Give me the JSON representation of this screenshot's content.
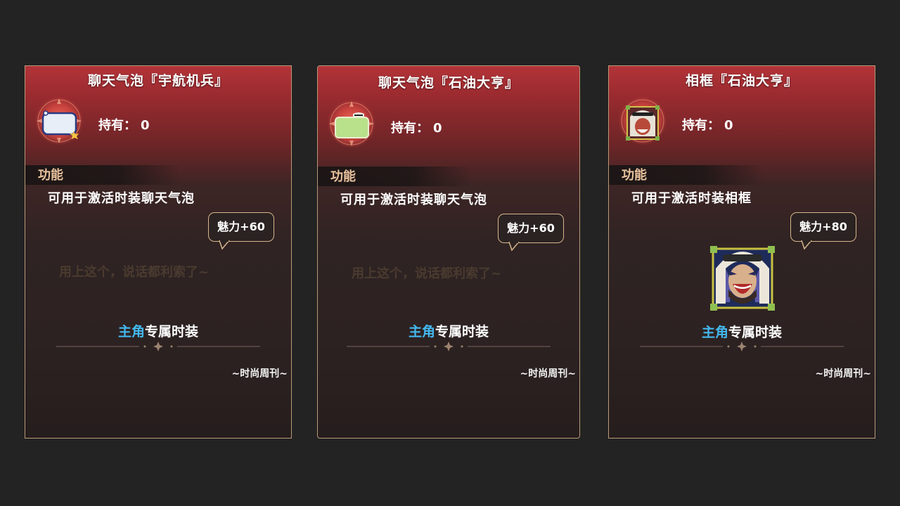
{
  "cards": [
    {
      "title": "聊天气泡『宇航机兵』",
      "owned_label": "持有：",
      "owned_value": "0",
      "section_label": "功能",
      "description": "可用于激活时装聊天气泡",
      "bonus": "魅力+60",
      "flavor_text": "用上这个，说话都利索了~",
      "exclusive_highlight": "主角",
      "exclusive_rest": "专属时装",
      "magazine": "~时尚周刊~",
      "icon": "chat-bubble-white-icon"
    },
    {
      "title": "聊天气泡『石油大亨』",
      "owned_label": "持有：",
      "owned_value": "0",
      "section_label": "功能",
      "description": "可用于激活时装聊天气泡",
      "bonus": "魅力+60",
      "flavor_text": "用上这个，说话都利索了~",
      "exclusive_highlight": "主角",
      "exclusive_rest": "专属时装",
      "magazine": "~时尚周刊~",
      "icon": "chat-bubble-green-icon"
    },
    {
      "title": "相框『石油大亨』",
      "owned_label": "持有：",
      "owned_value": "0",
      "section_label": "功能",
      "description": "可用于激活时装相框",
      "bonus": "魅力+80",
      "exclusive_highlight": "主角",
      "exclusive_rest": "专属时装",
      "magazine": "~时尚周刊~",
      "icon": "portrait-frame-icon"
    }
  ],
  "colors": {
    "card_top": "#b23438",
    "card_bottom": "#2b2121",
    "border": "#b89a78",
    "section_label": "#e9c29d",
    "highlight": "#43b8ee"
  }
}
